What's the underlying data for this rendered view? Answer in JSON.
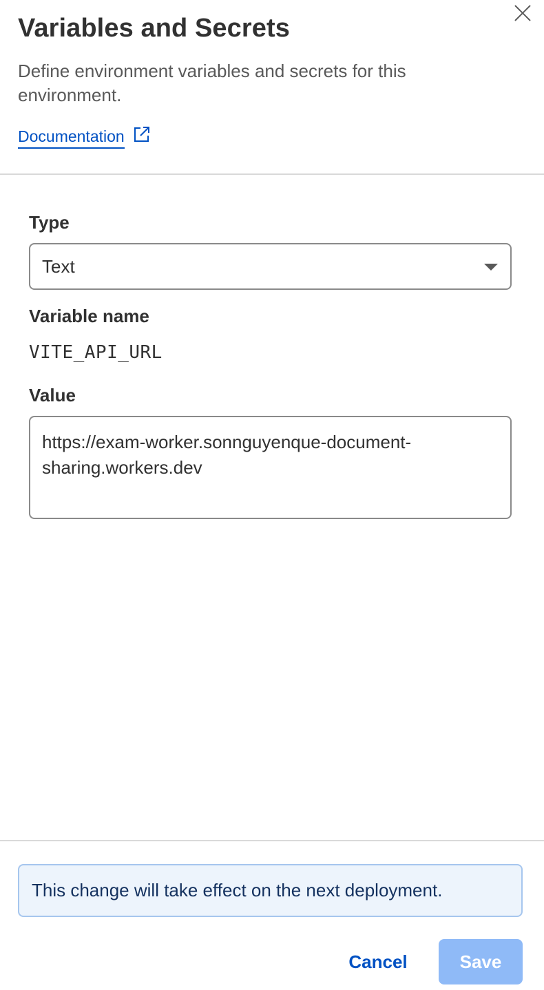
{
  "dialog": {
    "title": "Variables and Secrets",
    "subtitle": "Define environment variables and secrets for this environment.",
    "documentation_link": "Documentation",
    "close_icon": "close-icon"
  },
  "form": {
    "type": {
      "label": "Type",
      "selected": "Text"
    },
    "variable_name": {
      "label": "Variable name",
      "value": "VITE_API_URL"
    },
    "value": {
      "label": "Value",
      "value": "https://exam-worker.sonnguyenque-document-sharing.workers.dev"
    }
  },
  "notice": {
    "text": "This change will take effect on the next deployment."
  },
  "footer": {
    "cancel_label": "Cancel",
    "save_label": "Save"
  },
  "colors": {
    "link": "#0051c3",
    "save_disabled": "#8fbaf7",
    "notice_bg": "#edf4fc",
    "notice_border": "#a6c6ee"
  }
}
